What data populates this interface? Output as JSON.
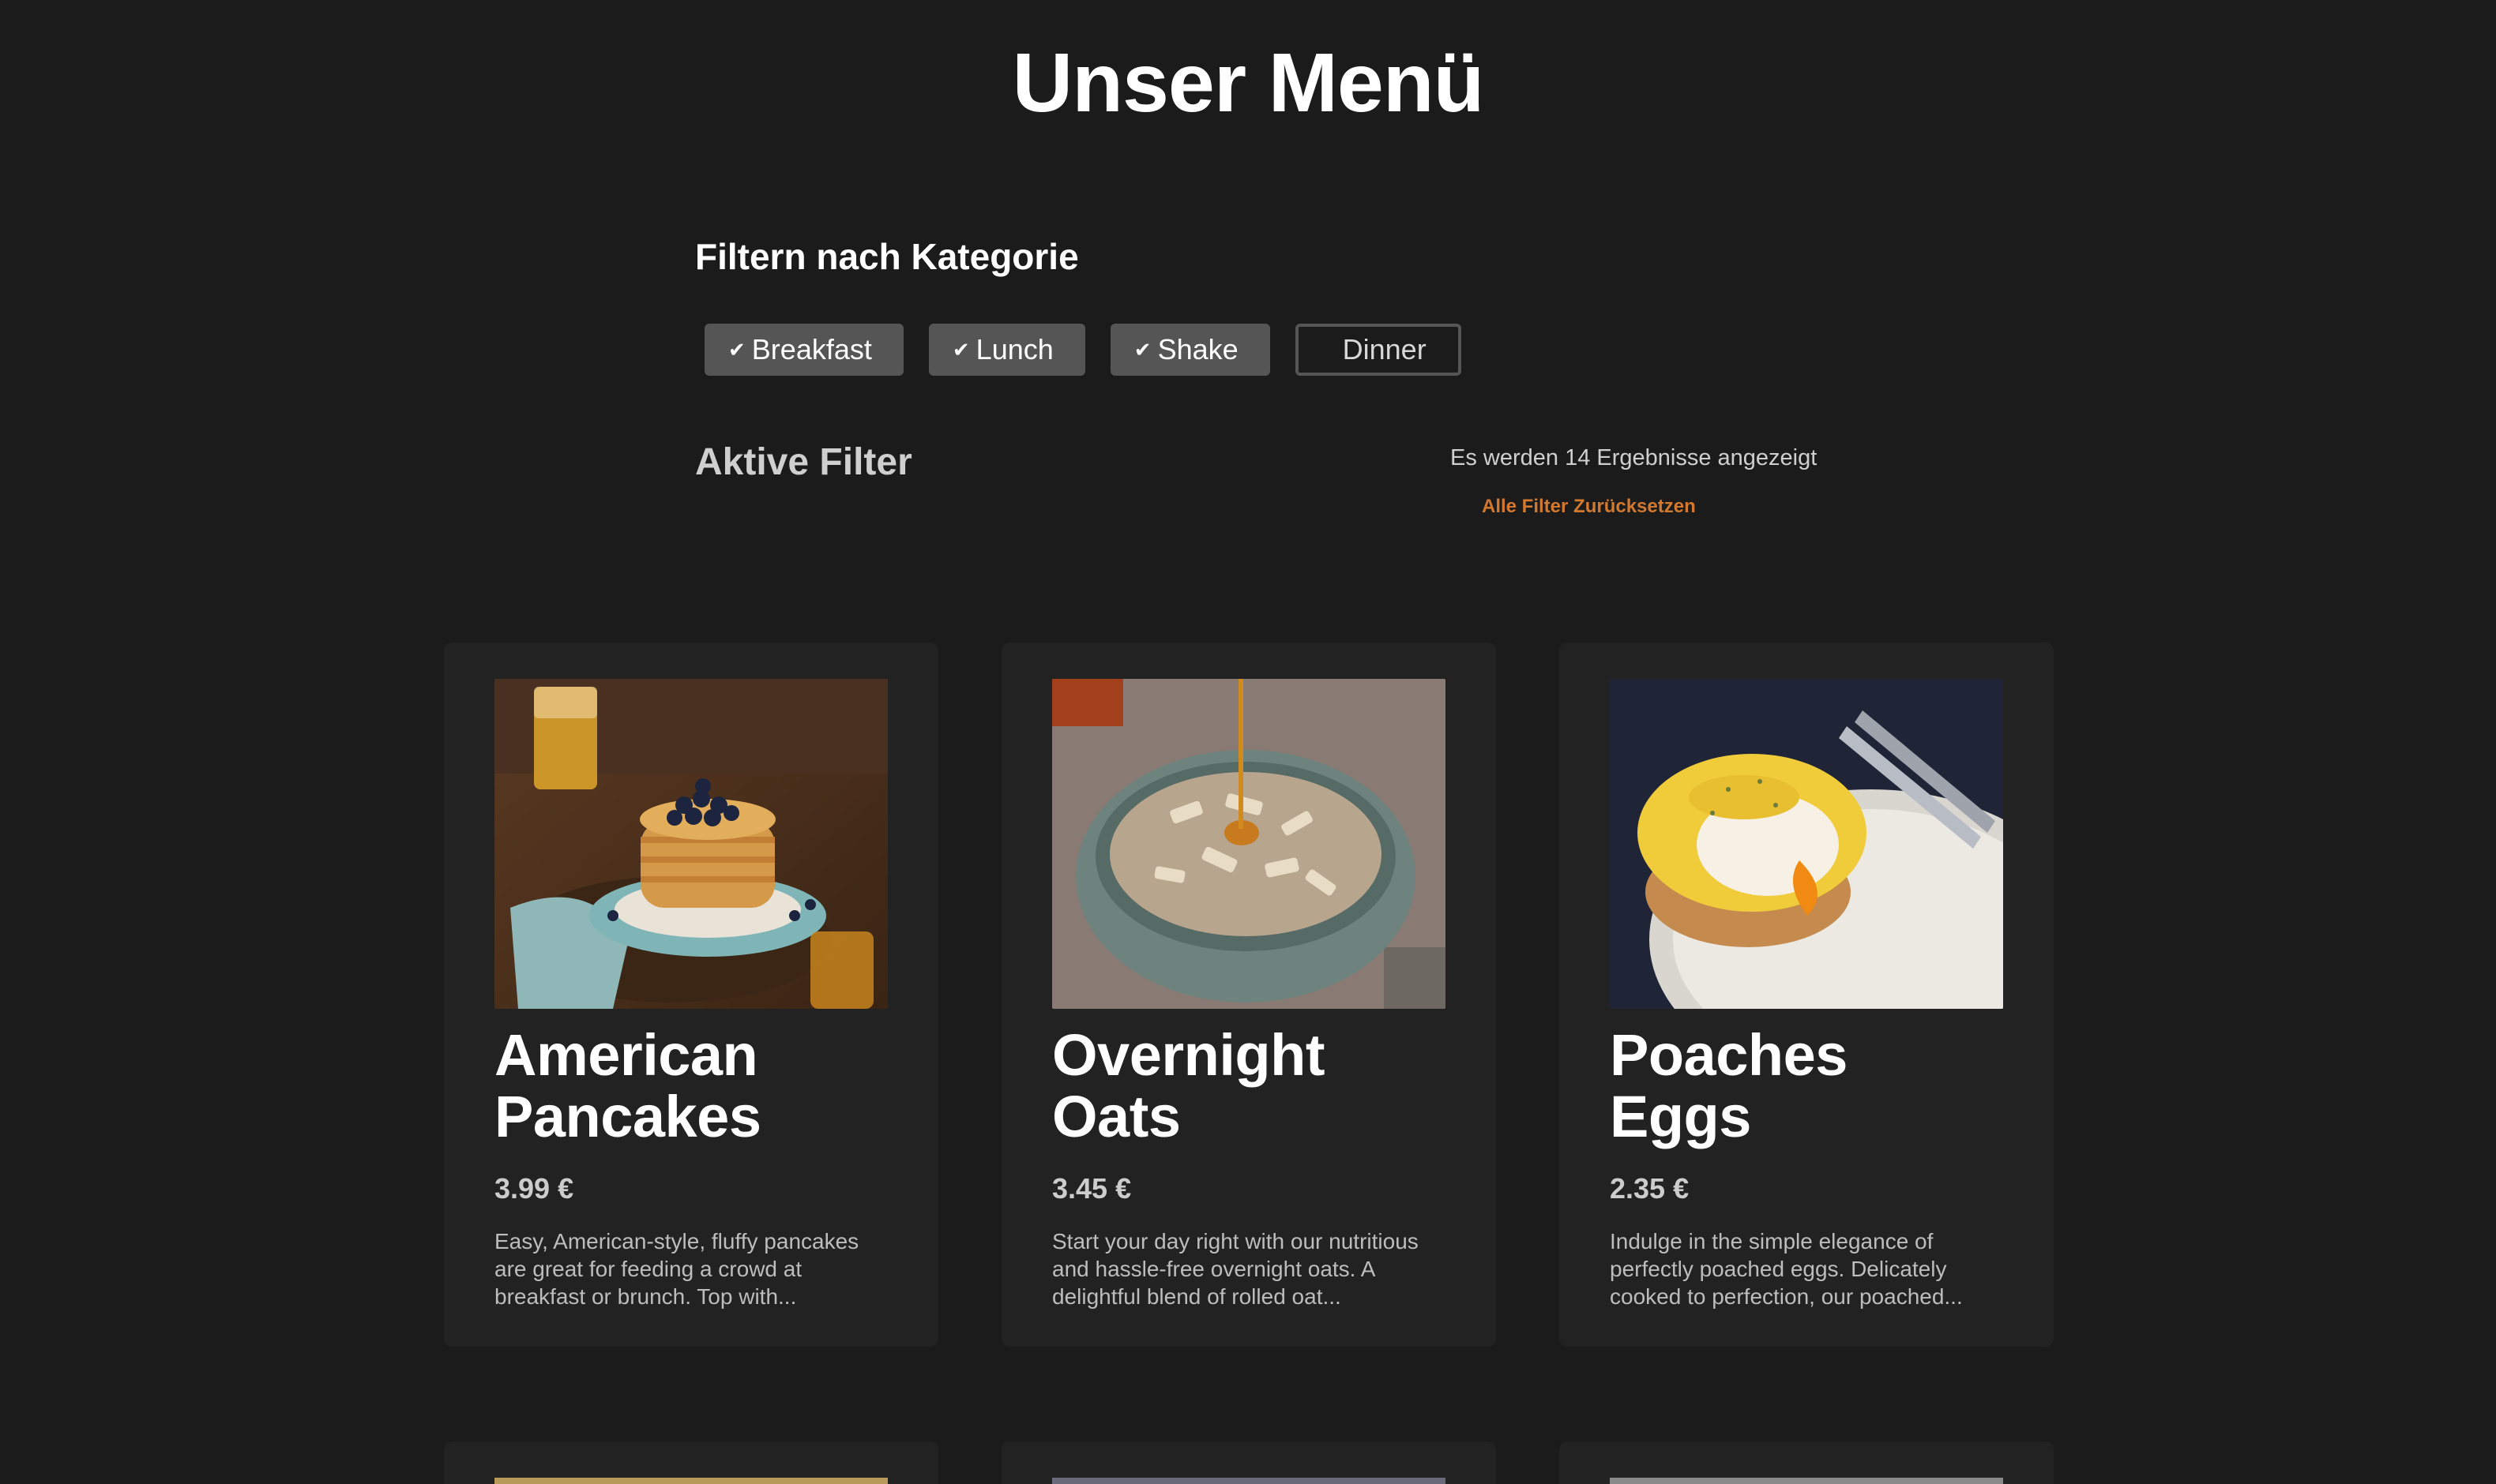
{
  "page": {
    "title": "Unser Menü"
  },
  "filters": {
    "heading": "Filtern nach Kategorie",
    "categories": [
      {
        "label": "Breakfast",
        "active": true
      },
      {
        "label": "Lunch",
        "active": true
      },
      {
        "label": "Shake",
        "active": true
      },
      {
        "label": "Dinner",
        "active": false
      }
    ],
    "active_label": "Aktive Filter",
    "result_text": "Es werden 14 Ergebnisse angezeigt",
    "reset_label": "Alle Filter Zurücksetzen"
  },
  "menu": {
    "items": [
      {
        "title": "American Pancakes",
        "price": "3.99 €",
        "description": "Easy, American-style, fluffy pancakes are great for feeding a crowd at breakfast or brunch. Top with...",
        "image_icon": "pancakes-photo"
      },
      {
        "title": "Overnight Oats",
        "price": "3.45 €",
        "description": "Start your day right with our nutritious and hassle-free overnight oats. A delightful blend of rolled oat...",
        "image_icon": "oats-photo"
      },
      {
        "title": "Poaches Eggs",
        "price": "2.35 €",
        "description": "Indulge in the simple elegance of perfectly poached eggs. Delicately cooked to perfection, our poached...",
        "image_icon": "eggs-photo"
      }
    ]
  },
  "colors": {
    "background": "#1b1b1b",
    "card": "#222222",
    "button_active": "#555555",
    "accent_link": "#d2782f"
  }
}
